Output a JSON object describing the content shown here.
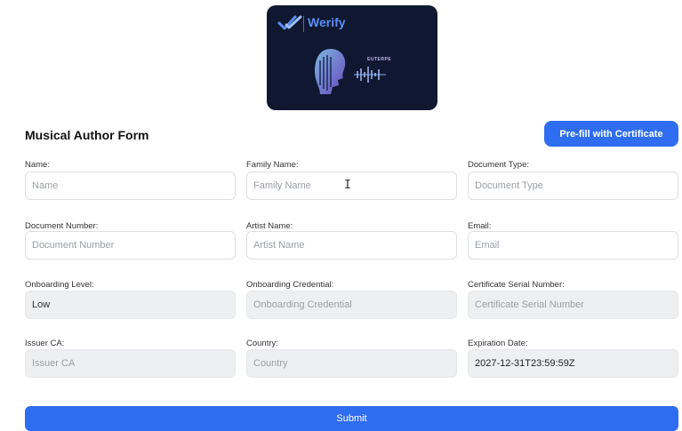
{
  "logo": {
    "wordmark": "Werify",
    "brand": "EUTERPE"
  },
  "form": {
    "title": "Musical Author Form",
    "prefill_label": "Pre-fill with Certificate",
    "submit_label": "Submit",
    "fields": [
      {
        "label": "Name:",
        "placeholder": "Name",
        "value": "",
        "disabled": false
      },
      {
        "label": "Family Name:",
        "placeholder": "Family Name",
        "value": "",
        "disabled": false
      },
      {
        "label": "Document Type:",
        "placeholder": "Document Type",
        "value": "",
        "disabled": false
      },
      {
        "label": "Document Number:",
        "placeholder": "Document Number",
        "value": "",
        "disabled": false
      },
      {
        "label": "Artist Name:",
        "placeholder": "Artist Name",
        "value": "",
        "disabled": false
      },
      {
        "label": "Email:",
        "placeholder": "Email",
        "value": "",
        "disabled": false
      },
      {
        "label": "Onboarding Level:",
        "placeholder": "",
        "value": "Low",
        "disabled": true
      },
      {
        "label": "Onboarding Credential:",
        "placeholder": "Onboarding Credential",
        "value": "",
        "disabled": true
      },
      {
        "label": "Certificate Serial Number:",
        "placeholder": "Certificate Serial Number",
        "value": "",
        "disabled": true
      },
      {
        "label": "Issuer CA:",
        "placeholder": "Issuer CA",
        "value": "",
        "disabled": true
      },
      {
        "label": "Country:",
        "placeholder": "Country",
        "value": "",
        "disabled": true
      },
      {
        "label": "Expiration Date:",
        "placeholder": "",
        "value": "2027-12-31T23:59:59Z",
        "disabled": true
      }
    ]
  },
  "colors": {
    "accent": "#2f6df0",
    "logo_background": "#0f1830"
  }
}
